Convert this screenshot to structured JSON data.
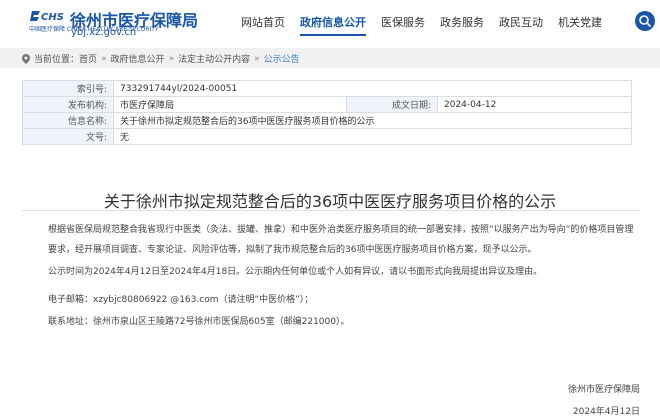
{
  "header": {
    "logo_mark": "CHS",
    "logo_sub": "中国医疗保障 CHINA HEALTHCARE SECURITY",
    "site_title": "徐州市医疗保障局",
    "site_url": "ybj.xz.gov.cn",
    "nav": [
      {
        "label": "网站首页",
        "active": false
      },
      {
        "label": "政府信息公开",
        "active": true
      },
      {
        "label": "医保服务",
        "active": false
      },
      {
        "label": "政务服务",
        "active": false
      },
      {
        "label": "政民互动",
        "active": false
      },
      {
        "label": "机关党建",
        "active": false
      }
    ],
    "search_icon": "search-icon"
  },
  "breadcrumb": {
    "prefix": "当前位置：",
    "items": [
      "首页",
      "政府信息公开",
      "法定主动公开内容",
      "公示公告"
    ],
    "separator": "»"
  },
  "meta": {
    "index_label": "索引号:",
    "index_value": "733291744yl/2024-00051",
    "org_label": "发布机构:",
    "org_value": "市医疗保障局",
    "date_label": "成文日期:",
    "date_value": "2024-04-12",
    "name_label": "信息名称:",
    "name_value": "关于徐州市拟定规范整合后的36项中医医疗服务项目价格的公示",
    "docno_label": "文号:",
    "docno_value": "无"
  },
  "article": {
    "title": "关于徐州市拟定规范整合后的36项中医医疗服务项目价格的公示",
    "p1": "根据省医保局规范整合我省现行中医类（灸法、拔罐、推拿）和中医外治类医疗服务项目的统一部署安排，按照“以服务产出为导向”的价格项目管理要求，经开展项目调查、专家论证、风险评估等，拟制了我市规范整合后的36项中医医疗服务项目价格方案，现予以公示。",
    "p2": "公示时间为2024年4月12日至2024年4月18日。公示期内任何单位或个人如有异议，请以书面形式向我局提出异议及理由。",
    "p3": "电子邮箱：xzybjc80806922 @163.com（请注明“中医价格”）；",
    "p4": "联系地址：徐州市泉山区王陵路72号徐州市医保局605室（邮编221000）。",
    "sign_org": "徐州市医疗保障局",
    "sign_date": "2024年4月12日"
  },
  "colors": {
    "brand": "#1a56a8",
    "link": "#3a7bd5",
    "table_label_bg": "#f0f4fa"
  }
}
